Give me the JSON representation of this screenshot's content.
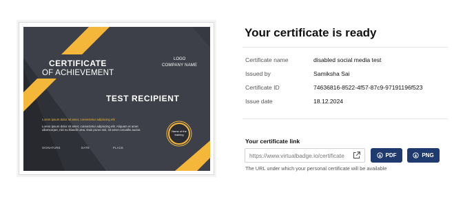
{
  "certificate_preview": {
    "title_line1": "CERTIFICATE",
    "title_line2": "OF ACHIEVEMENT",
    "logo": "LOGO",
    "company": "COMPANY NAME",
    "recipient": "TEST  RECIPIENT",
    "highlight_text": "Lorem ipsum dolor sit amet, consectetur adipiscing elit",
    "body_text": "Lorem ipsum dolor sit amet, consectetur adipiscing elit. Aliquam et amet ullamcorper, nisi eu blandit urna. Duis purus nisl, sit amet convallis auctor.",
    "signature_label": "SIGNATURE",
    "date_label": "DATE",
    "place_label": "PLACE",
    "seal_text": "Name of the training",
    "colors": {
      "background": "#3d4049",
      "accent": "#f4b73a"
    }
  },
  "panel": {
    "heading": "Your certificate is ready",
    "details": [
      {
        "label": "Certificate name",
        "value": "disabled social media test"
      },
      {
        "label": "Issued by",
        "value": "Samiksha Sai"
      },
      {
        "label": "Certificate ID",
        "value": "74636816-8522-4f57-87c9-97191196f523"
      },
      {
        "label": "Issue date",
        "value": "18.12.2024"
      }
    ],
    "link_title": "Your certificate link",
    "link_value": "https://www.virtualbadge.io/certificate",
    "open_icon": "external-link-icon",
    "pdf_label": "PDF",
    "png_label": "PNG",
    "download_icon": "download-circle-icon",
    "hint": "The URL under which your personal certificate will be available",
    "colors": {
      "button": "#1e3a6e"
    }
  }
}
